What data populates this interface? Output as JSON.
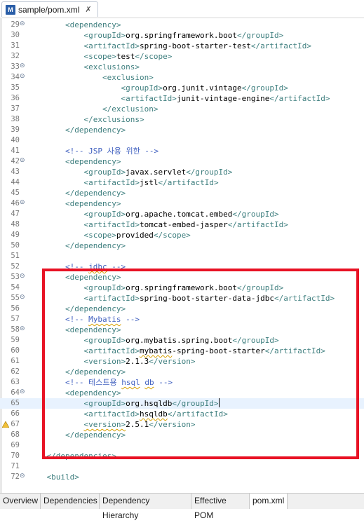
{
  "tab": {
    "title": "sample/pom.xml",
    "close": "✗"
  },
  "bottom_tabs": [
    "Overview",
    "Dependencies",
    "Dependency Hierarchy",
    "Effective POM",
    "pom.xml"
  ],
  "lines": [
    {
      "n": "29",
      "fold": true,
      "indent": "        ",
      "parts": [
        [
          "t",
          "<dependency>"
        ]
      ]
    },
    {
      "n": "30",
      "indent": "            ",
      "parts": [
        [
          "t",
          "<groupId>"
        ],
        [
          "txt",
          "org.springframework.boot"
        ],
        [
          "t",
          "</groupId>"
        ]
      ]
    },
    {
      "n": "31",
      "indent": "            ",
      "parts": [
        [
          "t",
          "<artifactId>"
        ],
        [
          "txt",
          "spring-boot-starter-test"
        ],
        [
          "t",
          "</artifactId>"
        ]
      ]
    },
    {
      "n": "32",
      "indent": "            ",
      "parts": [
        [
          "t",
          "<scope>"
        ],
        [
          "txt",
          "test"
        ],
        [
          "t",
          "</scope>"
        ]
      ]
    },
    {
      "n": "33",
      "fold": true,
      "indent": "            ",
      "parts": [
        [
          "t",
          "<exclusions>"
        ]
      ]
    },
    {
      "n": "34",
      "fold": true,
      "indent": "                ",
      "parts": [
        [
          "t",
          "<exclusion>"
        ]
      ]
    },
    {
      "n": "35",
      "indent": "                    ",
      "parts": [
        [
          "t",
          "<groupId>"
        ],
        [
          "txt",
          "org.junit.vintage"
        ],
        [
          "t",
          "</groupId>"
        ]
      ]
    },
    {
      "n": "36",
      "indent": "                    ",
      "parts": [
        [
          "t",
          "<artifactId>"
        ],
        [
          "txt",
          "junit-vintage-engine"
        ],
        [
          "t",
          "</artifactId>"
        ]
      ]
    },
    {
      "n": "37",
      "indent": "                ",
      "parts": [
        [
          "t",
          "</exclusion>"
        ]
      ]
    },
    {
      "n": "38",
      "indent": "            ",
      "parts": [
        [
          "t",
          "</exclusions>"
        ]
      ]
    },
    {
      "n": "39",
      "indent": "        ",
      "parts": [
        [
          "t",
          "</dependency>"
        ]
      ]
    },
    {
      "n": "40",
      "indent": "",
      "parts": []
    },
    {
      "n": "41",
      "indent": "        ",
      "parts": [
        [
          "cmt",
          "<!-- JSP 사용 위한 -->"
        ]
      ]
    },
    {
      "n": "42",
      "fold": true,
      "indent": "        ",
      "parts": [
        [
          "t",
          "<dependency>"
        ]
      ]
    },
    {
      "n": "43",
      "indent": "            ",
      "parts": [
        [
          "t",
          "<groupId>"
        ],
        [
          "txt",
          "javax.servlet"
        ],
        [
          "t",
          "</groupId>"
        ]
      ]
    },
    {
      "n": "44",
      "indent": "            ",
      "parts": [
        [
          "t",
          "<artifactId>"
        ],
        [
          "txt",
          "jstl"
        ],
        [
          "t",
          "</artifactId>"
        ]
      ]
    },
    {
      "n": "45",
      "indent": "        ",
      "parts": [
        [
          "t",
          "</dependency>"
        ]
      ]
    },
    {
      "n": "46",
      "fold": true,
      "indent": "        ",
      "parts": [
        [
          "t",
          "<dependency>"
        ]
      ]
    },
    {
      "n": "47",
      "indent": "            ",
      "parts": [
        [
          "t",
          "<groupId>"
        ],
        [
          "txt",
          "org.apache.tomcat.embed"
        ],
        [
          "t",
          "</groupId>"
        ]
      ]
    },
    {
      "n": "48",
      "indent": "            ",
      "parts": [
        [
          "t",
          "<artifactId>"
        ],
        [
          "txt",
          "tomcat-embed-jasper"
        ],
        [
          "t",
          "</artifactId>"
        ]
      ]
    },
    {
      "n": "49",
      "indent": "            ",
      "parts": [
        [
          "t",
          "<scope>"
        ],
        [
          "txt",
          "provided"
        ],
        [
          "t",
          "</scope>"
        ]
      ]
    },
    {
      "n": "50",
      "indent": "        ",
      "parts": [
        [
          "t",
          "</dependency>"
        ]
      ]
    },
    {
      "n": "51",
      "indent": "",
      "parts": []
    },
    {
      "n": "52",
      "indent": "        ",
      "parts": [
        [
          "cmt",
          "<!-- "
        ],
        [
          "cmtsq",
          "jdbc"
        ],
        [
          "cmt",
          " -->"
        ]
      ]
    },
    {
      "n": "53",
      "fold": true,
      "indent": "        ",
      "parts": [
        [
          "t",
          "<dependency>"
        ]
      ]
    },
    {
      "n": "54",
      "indent": "            ",
      "parts": [
        [
          "t",
          "<groupId>"
        ],
        [
          "txt",
          "org.springframework.boot"
        ],
        [
          "t",
          "</groupId>"
        ]
      ]
    },
    {
      "n": "55",
      "fold": true,
      "indent": "            ",
      "parts": [
        [
          "t",
          "<artifactId>"
        ],
        [
          "txt",
          "spring-boot-starter-data-jdbc"
        ],
        [
          "t",
          "</artifactId>"
        ]
      ]
    },
    {
      "n": "56",
      "indent": "        ",
      "parts": [
        [
          "t",
          "</dependency>"
        ]
      ]
    },
    {
      "n": "57",
      "indent": "        ",
      "parts": [
        [
          "cmt",
          "<!-- "
        ],
        [
          "cmtsq",
          "Mybatis"
        ],
        [
          "cmt",
          " -->"
        ]
      ]
    },
    {
      "n": "58",
      "fold": true,
      "indent": "        ",
      "parts": [
        [
          "t",
          "<dependency>"
        ]
      ]
    },
    {
      "n": "59",
      "indent": "            ",
      "parts": [
        [
          "t",
          "<groupId>"
        ],
        [
          "txt",
          "org.mybatis.spring.boot"
        ],
        [
          "t",
          "</groupId>"
        ]
      ]
    },
    {
      "n": "60",
      "indent": "            ",
      "parts": [
        [
          "t",
          "<artifactId>"
        ],
        [
          "txtsq",
          "mybatis"
        ],
        [
          "txt",
          "-spring-boot-starter"
        ],
        [
          "t",
          "</artifactId>"
        ]
      ]
    },
    {
      "n": "61",
      "indent": "            ",
      "parts": [
        [
          "t",
          "<version>"
        ],
        [
          "txt",
          "2.1.3"
        ],
        [
          "t",
          "</version>"
        ]
      ]
    },
    {
      "n": "62",
      "indent": "        ",
      "parts": [
        [
          "t",
          "</dependency>"
        ]
      ]
    },
    {
      "n": "63",
      "indent": "        ",
      "parts": [
        [
          "cmt",
          "<!-- 테스트용 "
        ],
        [
          "cmtsq",
          "hsql"
        ],
        [
          "cmt",
          " "
        ],
        [
          "cmtsq",
          "db"
        ],
        [
          "cmt",
          " -->"
        ]
      ]
    },
    {
      "n": "64",
      "fold": true,
      "indent": "        ",
      "parts": [
        [
          "t",
          "<dependency>"
        ]
      ]
    },
    {
      "n": "65",
      "current": true,
      "indent": "            ",
      "parts": [
        [
          "t",
          "<groupId>"
        ],
        [
          "txt",
          "org.hsqldb"
        ],
        [
          "t",
          "</groupId>"
        ],
        [
          "caret",
          ""
        ]
      ]
    },
    {
      "n": "66",
      "indent": "            ",
      "parts": [
        [
          "t",
          "<artifactId>"
        ],
        [
          "txtsq",
          "hsqldb"
        ],
        [
          "t",
          "</artifactId>"
        ]
      ]
    },
    {
      "n": "67",
      "warn": true,
      "indent": "            ",
      "parts": [
        [
          "tsq",
          "<version>"
        ],
        [
          "txt",
          "2.5.1"
        ],
        [
          "t",
          "</version>"
        ]
      ]
    },
    {
      "n": "68",
      "indent": "        ",
      "parts": [
        [
          "t",
          "</dependency>"
        ]
      ]
    },
    {
      "n": "69",
      "indent": "",
      "parts": []
    },
    {
      "n": "70",
      "indent": "    ",
      "parts": [
        [
          "t",
          "</dependencies>"
        ]
      ]
    },
    {
      "n": "71",
      "indent": "",
      "parts": []
    },
    {
      "n": "72",
      "fold": true,
      "indent": "    ",
      "parts": [
        [
          "t",
          "<build>"
        ]
      ]
    }
  ]
}
